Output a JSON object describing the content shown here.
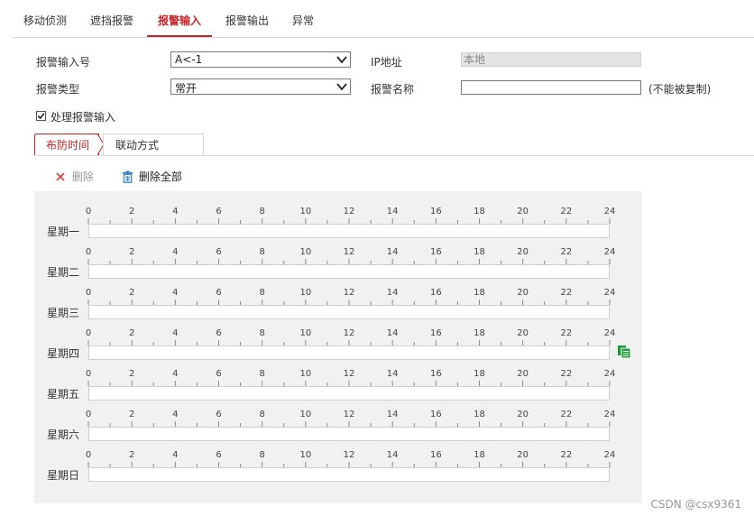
{
  "tabs": [
    "移动侦测",
    "遮挡报警",
    "报警输入",
    "报警输出",
    "异常"
  ],
  "active_tab": "报警输入",
  "form": {
    "alarm_input_no_label": "报警输入号",
    "alarm_input_no_value": "A<-1",
    "ip_label": "IP地址",
    "ip_value": "本地",
    "alarm_type_label": "报警类型",
    "alarm_type_value": "常开",
    "alarm_name_label": "报警名称",
    "alarm_name_value": "",
    "alarm_name_note": "(不能被复制)",
    "handle_alarm_label": "处理报警输入",
    "handle_alarm_checked": true
  },
  "subtabs": [
    "布防时间",
    "联动方式"
  ],
  "active_subtab": "布防时间",
  "toolbar": {
    "delete_label": "删除",
    "delete_all_label": "删除全部"
  },
  "schedule": {
    "hour_labels": [
      "0",
      "2",
      "4",
      "6",
      "8",
      "10",
      "12",
      "14",
      "16",
      "18",
      "20",
      "22",
      "24"
    ],
    "days": [
      "星期一",
      "星期二",
      "星期三",
      "星期四",
      "星期五",
      "星期六",
      "星期日"
    ],
    "copy_icon_day": "星期四"
  },
  "colors": {
    "accent": "#c9252b",
    "copy_icon": "#1f9d3a",
    "trash_icon": "#2f7fc6"
  },
  "watermark": "CSDN @csx9361"
}
